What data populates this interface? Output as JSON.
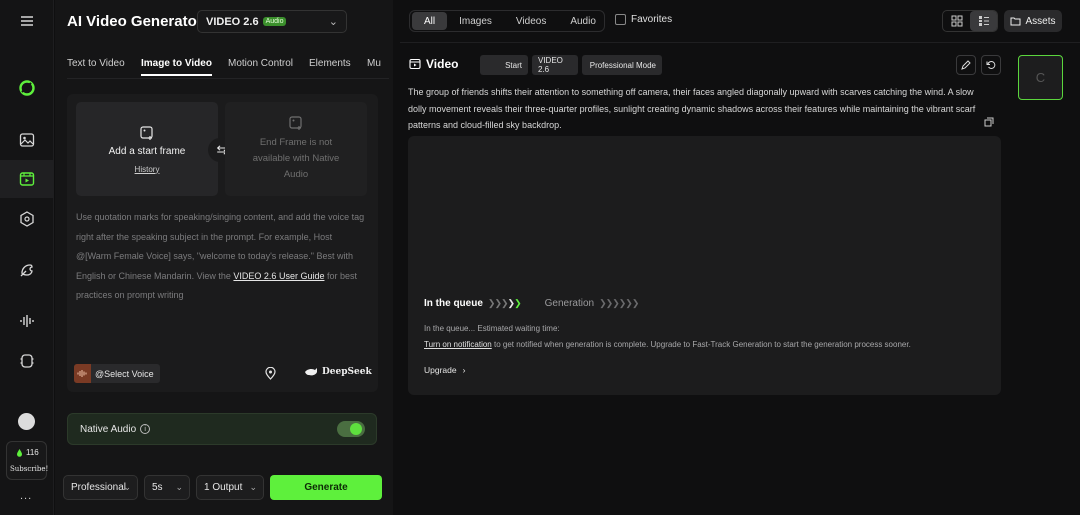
{
  "sidebar": {
    "items": [
      {
        "name": "home-logo-icon"
      },
      {
        "name": "image-icon"
      },
      {
        "name": "video-icon"
      },
      {
        "name": "effects-icon"
      },
      {
        "name": "canvas-icon"
      },
      {
        "name": "audio-icon"
      },
      {
        "name": "tools-icon"
      }
    ],
    "credits": "116",
    "subscribe_label": "Subscribe!",
    "more_label": "..."
  },
  "panel": {
    "app_title": "AI Video Generator",
    "model_name": "VIDEO 2.6",
    "model_badge": "Audio",
    "tabs": [
      {
        "label": "Text to Video"
      },
      {
        "label": "Image to Video"
      },
      {
        "label": "Motion Control"
      },
      {
        "label": "Elements"
      },
      {
        "label": "Mu"
      }
    ],
    "start_frame_label": "Add a start frame",
    "history_label": "History",
    "end_frame_label": "End Frame is not available with Native Audio",
    "hint_part1": "Use quotation marks for speaking/singing content, and add the voice tag right after the speaking subject in the prompt. For example, Host @[Warm Female Voice] says, \"welcome to today's release.\" Best with English or Chinese Mandarin. View the ",
    "hint_link": "VIDEO 2.6 User Guide",
    "hint_part2": " for best practices on prompt writing",
    "voice_label": "@Select Voice",
    "deepseek_label": "DeepSeek",
    "native_audio_label": "Native Audio",
    "native_audio_on": true,
    "mode_select": "Professional",
    "duration_select": "5s",
    "output_select": "1 Output",
    "generate_label": "Generate"
  },
  "topbar": {
    "filters": [
      "All",
      "Images",
      "Videos",
      "Audio"
    ],
    "active_filter": "All",
    "favorites_label": "Favorites",
    "assets_label": "Assets"
  },
  "task": {
    "title": "Video",
    "chips": [
      "Start",
      "VIDEO 2.6",
      "Professional Mode"
    ],
    "prompt": "The group of friends shifts their attention to something off camera, their faces angled diagonally upward with scarves catching the wind. A slow dolly movement reveals their three-quarter profiles, sunlight creating dynamic shadows across their features while maintaining the vibrant scarf patterns and cloud-filled sky backdrop.",
    "queue_step": "In the queue",
    "generation_step": "Generation",
    "estimated_text": "In the queue... Estimated waiting time:",
    "notify_link": "Turn on notification",
    "notify_text": " to get notified when generation is complete. Upgrade to Fast-Track Generation to start the generation process sooner.",
    "upgrade_label": "Upgrade",
    "thumb_label": "C"
  },
  "colors": {
    "accent": "#5ef03c",
    "background": "#0f0f10",
    "panel": "#151516"
  }
}
